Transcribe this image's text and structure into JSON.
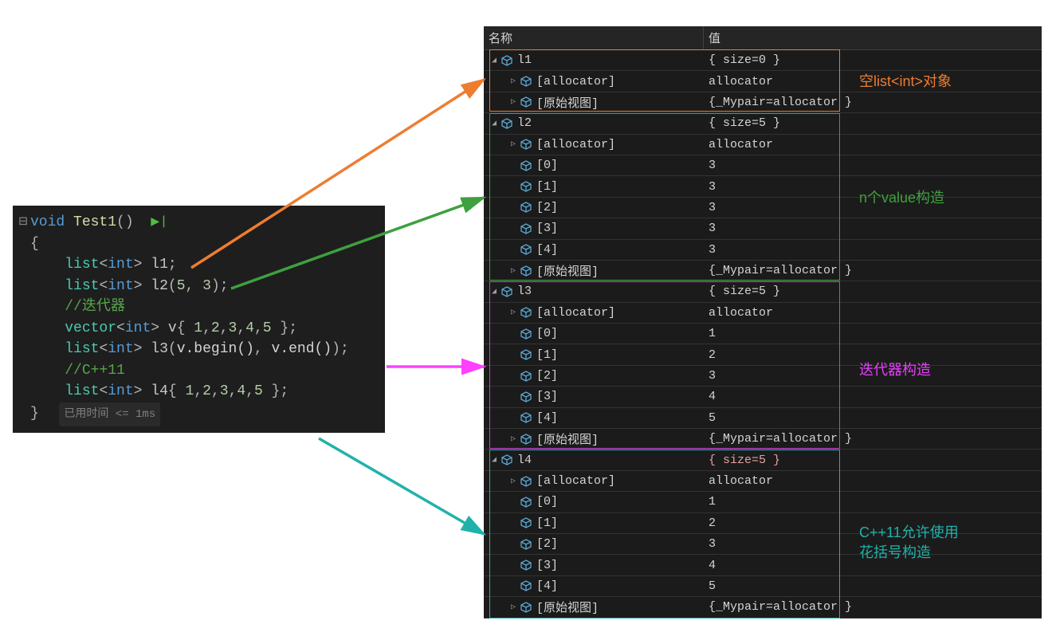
{
  "code": {
    "fn_signature": {
      "kw": "void",
      "name": "Test1",
      "parens": "()"
    },
    "open_brace": "{",
    "l1_decl": {
      "type_outer": "list",
      "type_inner": "int",
      "id": "l1"
    },
    "l2_decl": {
      "type_outer": "list",
      "type_inner": "int",
      "id": "l2",
      "arg1": "5",
      "arg2": "3"
    },
    "comment1": "//迭代器",
    "vec_decl": {
      "type_outer": "vector",
      "type_inner": "int",
      "id": "v",
      "vals": [
        "1",
        "2",
        "3",
        "4",
        "5"
      ]
    },
    "l3_decl": {
      "type_outer": "list",
      "type_inner": "int",
      "id": "l3",
      "call1": "v.begin()",
      "call2": "v.end()"
    },
    "comment2": "//C++11",
    "l4_decl": {
      "type_outer": "list",
      "type_inner": "int",
      "id": "l4",
      "vals": [
        "1",
        "2",
        "3",
        "4",
        "5"
      ]
    },
    "close_brace": "}",
    "timing": "已用时间 <= 1ms"
  },
  "watch": {
    "headers": {
      "name": "名称",
      "value": "值"
    },
    "rows": [
      {
        "depth": 0,
        "expander": "down",
        "icon": true,
        "name": "l1",
        "value": "{ size=0 }",
        "changed": false
      },
      {
        "depth": 1,
        "expander": "right",
        "icon": true,
        "name": "[allocator]",
        "value": "allocator",
        "changed": false
      },
      {
        "depth": 1,
        "expander": "right",
        "icon": true,
        "name": "[原始视图]",
        "value": "{_Mypair=allocator }",
        "changed": false
      },
      {
        "depth": 0,
        "expander": "down",
        "icon": true,
        "name": "l2",
        "value": "{ size=5 }",
        "changed": false
      },
      {
        "depth": 1,
        "expander": "right",
        "icon": true,
        "name": "[allocator]",
        "value": "allocator",
        "changed": false
      },
      {
        "depth": 1,
        "expander": "none",
        "icon": true,
        "name": "[0]",
        "value": "3",
        "changed": false
      },
      {
        "depth": 1,
        "expander": "none",
        "icon": true,
        "name": "[1]",
        "value": "3",
        "changed": false
      },
      {
        "depth": 1,
        "expander": "none",
        "icon": true,
        "name": "[2]",
        "value": "3",
        "changed": false
      },
      {
        "depth": 1,
        "expander": "none",
        "icon": true,
        "name": "[3]",
        "value": "3",
        "changed": false
      },
      {
        "depth": 1,
        "expander": "none",
        "icon": true,
        "name": "[4]",
        "value": "3",
        "changed": false
      },
      {
        "depth": 1,
        "expander": "right",
        "icon": true,
        "name": "[原始视图]",
        "value": "{_Mypair=allocator }",
        "changed": false
      },
      {
        "depth": 0,
        "expander": "down",
        "icon": true,
        "name": "l3",
        "value": "{ size=5 }",
        "changed": false
      },
      {
        "depth": 1,
        "expander": "right",
        "icon": true,
        "name": "[allocator]",
        "value": "allocator",
        "changed": false
      },
      {
        "depth": 1,
        "expander": "none",
        "icon": true,
        "name": "[0]",
        "value": "1",
        "changed": false
      },
      {
        "depth": 1,
        "expander": "none",
        "icon": true,
        "name": "[1]",
        "value": "2",
        "changed": false
      },
      {
        "depth": 1,
        "expander": "none",
        "icon": true,
        "name": "[2]",
        "value": "3",
        "changed": false
      },
      {
        "depth": 1,
        "expander": "none",
        "icon": true,
        "name": "[3]",
        "value": "4",
        "changed": false
      },
      {
        "depth": 1,
        "expander": "none",
        "icon": true,
        "name": "[4]",
        "value": "5",
        "changed": false
      },
      {
        "depth": 1,
        "expander": "right",
        "icon": true,
        "name": "[原始视图]",
        "value": "{_Mypair=allocator }",
        "changed": false
      },
      {
        "depth": 0,
        "expander": "down",
        "icon": true,
        "name": "l4",
        "value": "{ size=5 }",
        "changed": true
      },
      {
        "depth": 1,
        "expander": "right",
        "icon": true,
        "name": "[allocator]",
        "value": "allocator",
        "changed": false
      },
      {
        "depth": 1,
        "expander": "none",
        "icon": true,
        "name": "[0]",
        "value": "1",
        "changed": false
      },
      {
        "depth": 1,
        "expander": "none",
        "icon": true,
        "name": "[1]",
        "value": "2",
        "changed": false
      },
      {
        "depth": 1,
        "expander": "none",
        "icon": true,
        "name": "[2]",
        "value": "3",
        "changed": false
      },
      {
        "depth": 1,
        "expander": "none",
        "icon": true,
        "name": "[3]",
        "value": "4",
        "changed": false
      },
      {
        "depth": 1,
        "expander": "none",
        "icon": true,
        "name": "[4]",
        "value": "5",
        "changed": false
      },
      {
        "depth": 1,
        "expander": "right",
        "icon": true,
        "name": "[原始视图]",
        "value": "{_Mypair=allocator }",
        "changed": false
      }
    ]
  },
  "annotations": {
    "a1": {
      "text": "空list<int>对象",
      "color": "#ED7D31"
    },
    "a2": {
      "text": "n个value构造",
      "color": "#3EA03E"
    },
    "a3": {
      "text": "迭代器构造",
      "color": "#E83EFF"
    },
    "a4": {
      "text": "C++11允许使用花括号构造",
      "color": "#20B2AA"
    }
  },
  "boxes": {
    "b1": {
      "color": "#ED7D31"
    },
    "b2": {
      "color": "#3EA03E"
    },
    "b3": {
      "color": "#C040D0"
    },
    "b4": {
      "color": "#20B2AA"
    }
  },
  "arrows": {
    "ar1": {
      "color": "#ED7D31"
    },
    "ar2": {
      "color": "#3EA03E"
    },
    "ar3": {
      "color": "#FF40FF"
    },
    "ar4": {
      "color": "#20B2AA"
    }
  }
}
